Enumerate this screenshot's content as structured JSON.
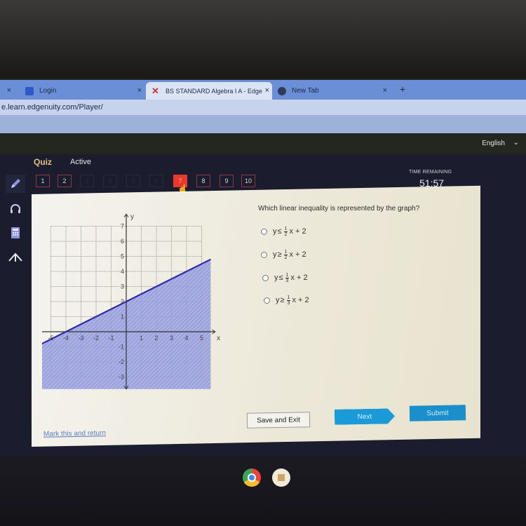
{
  "browser": {
    "tabs": [
      {
        "label": "",
        "close": "×"
      },
      {
        "label": "Login",
        "close": "×"
      },
      {
        "label": "BS STANDARD Algebra I A - Edge",
        "close": "×",
        "active": true
      },
      {
        "label": "New Tab",
        "close": "×"
      }
    ],
    "new_tab": "+",
    "url": "e.learn.edgenuity.com/Player/"
  },
  "header": {
    "language": "English",
    "language_chevron": "⌄",
    "quiz_label": "Quiz",
    "status": "Active",
    "time_label": "TIME REMAINING",
    "time_value": "51:57"
  },
  "question_nav": {
    "items": [
      {
        "label": "1"
      },
      {
        "label": "2"
      },
      {
        "label": "3"
      },
      {
        "label": "4"
      },
      {
        "label": "5"
      },
      {
        "label": "6"
      },
      {
        "label": "7",
        "current": true
      },
      {
        "label": "8"
      },
      {
        "label": "9"
      },
      {
        "label": "10"
      }
    ]
  },
  "sidebar": {
    "tools": [
      "pencil-icon",
      "headphones-icon",
      "calculator-icon",
      "collapse-icon"
    ]
  },
  "question": {
    "prompt": "Which linear inequality is represented by the graph?",
    "options": [
      {
        "prefix": "y",
        "symbol": "≤",
        "num": "1",
        "den": "2",
        "suffix": "x + 2"
      },
      {
        "prefix": "y",
        "symbol": "≥",
        "num": "1",
        "den": "2",
        "suffix": "x + 2"
      },
      {
        "prefix": "y",
        "symbol": "≤",
        "num": "1",
        "den": "3",
        "suffix": "x + 2"
      },
      {
        "prefix": "y",
        "symbol": "≥",
        "num": "1",
        "den": "3",
        "suffix": "x + 2"
      }
    ]
  },
  "graph": {
    "x_label": "x",
    "y_label": "y",
    "x_range": [
      -5,
      5
    ],
    "y_range": [
      -3,
      7
    ],
    "x_ticks": [
      "-5",
      "-4",
      "-3",
      "-2",
      "-1",
      "1",
      "2",
      "3",
      "4",
      "5"
    ],
    "y_ticks": [
      "-3",
      "-2",
      "-1",
      "1",
      "2",
      "3",
      "4",
      "5",
      "6",
      "7"
    ],
    "line": {
      "slope": 0.5,
      "intercept": 2
    },
    "shading": "below",
    "line_color": "#2b2fa8",
    "shade_color": "#8f97dc"
  },
  "actions": {
    "save_exit": "Save and Exit",
    "next": "Next",
    "submit": "Submit",
    "mark_return": "Mark this and return"
  },
  "colors": {
    "current_question": "#e8392c",
    "primary_button": "#1a9ad6",
    "quiz_label": "#e8c07a"
  }
}
